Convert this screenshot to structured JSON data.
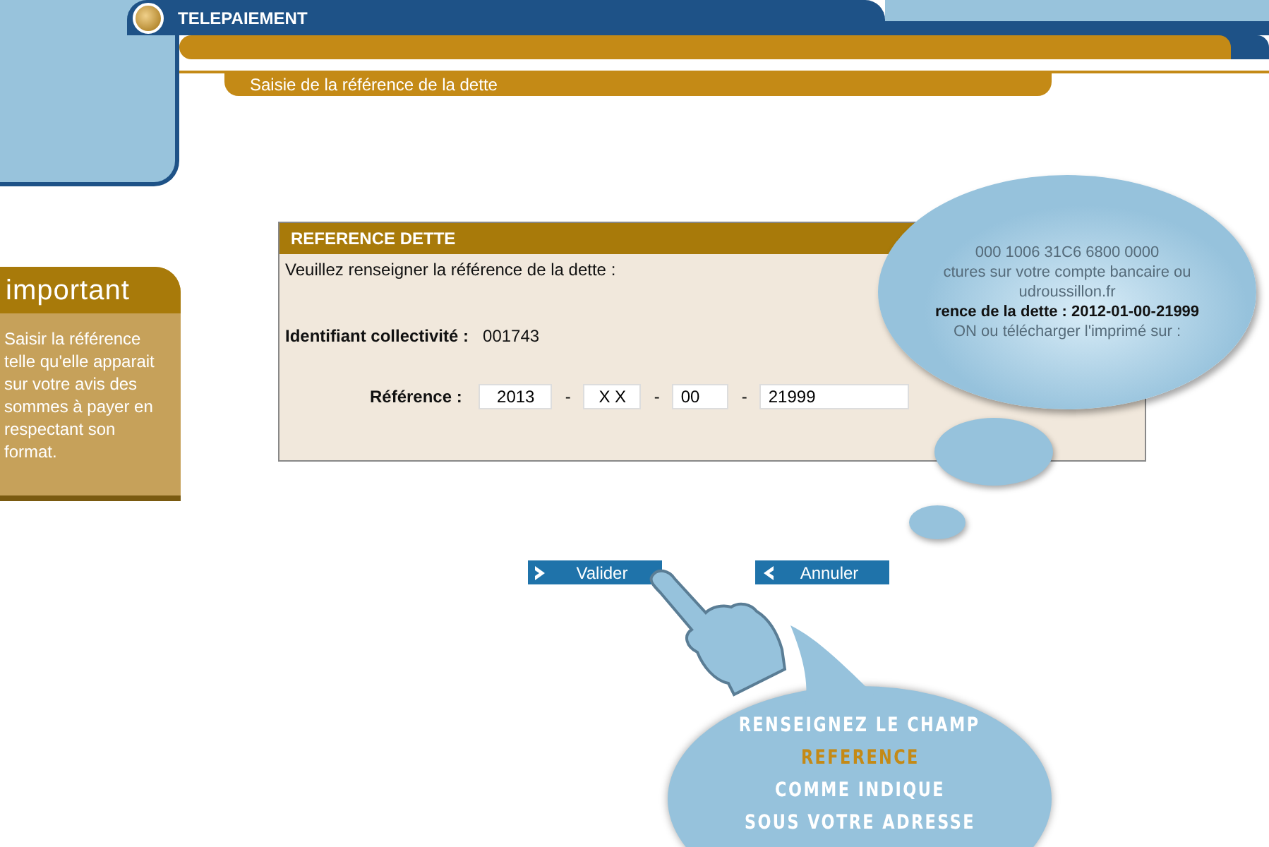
{
  "header": {
    "title": "TELEPAIEMENT",
    "subtitle": "Saisie de la référence de la dette"
  },
  "sidebar": {
    "title": "important",
    "text": "Saisir la référence telle qu'elle apparait sur votre avis des sommes à payer en respectant son format."
  },
  "form": {
    "title": "REFERENCE DETTE",
    "instruction": "Veuillez renseigner la référence de la dette :",
    "identifier": {
      "label": "Identifiant collectivité :",
      "value": "001743"
    },
    "reference": {
      "label": "Référence :",
      "parts": [
        "2013",
        "X X",
        "00",
        "21999"
      ],
      "separator": "-"
    }
  },
  "buttons": [
    {
      "label": "Valider",
      "kind": "next"
    },
    {
      "label": "Annuler",
      "kind": "back"
    }
  ],
  "zoom_bubble": {
    "lines": [
      {
        "text": "000 1006 31C6 6800 0000",
        "bold": false
      },
      {
        "text": "ctures sur votre compte bancaire ou",
        "bold": false
      },
      {
        "text": "udroussillon.fr",
        "bold": false
      },
      {
        "text": "rence de la dette : 2012-01-00-21999",
        "bold": true
      },
      {
        "text": "ON ou télécharger l'imprimé sur :",
        "bold": false
      }
    ]
  },
  "hint_bubble": {
    "lines": [
      {
        "text": "RENSEIGNEZ LE CHAMP",
        "highlight": false
      },
      {
        "text": "REFERENCE",
        "highlight": true
      },
      {
        "text": "COMME INDIQUE",
        "highlight": false
      },
      {
        "text": "SOUS VOTRE ADRESSE",
        "highlight": false
      }
    ]
  }
}
